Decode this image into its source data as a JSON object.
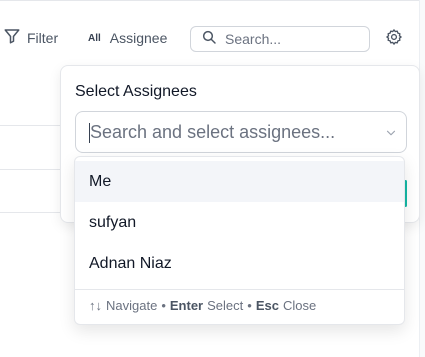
{
  "toolbar": {
    "filter_label": "Filter",
    "assignee_badge": "All",
    "assignee_label": "Assignee",
    "search_placeholder": "Search..."
  },
  "popover": {
    "title": "Select Assignees",
    "select_placeholder": "Search and select assignees..."
  },
  "dropdown": {
    "options": [
      "Me",
      "sufyan",
      "Adnan Niaz"
    ],
    "hint": {
      "arrows": "↑↓",
      "navigate": "Navigate",
      "sep": "•",
      "enter_key": "Enter",
      "select": "Select",
      "esc_key": "Esc",
      "close": "Close"
    }
  },
  "colors": {
    "accent": "#14b8a6",
    "hover_row": "#f3f5f9",
    "border": "#d1d5db"
  },
  "icons": [
    "filter-icon",
    "search-icon",
    "gear-icon",
    "chevron-down-icon"
  ]
}
